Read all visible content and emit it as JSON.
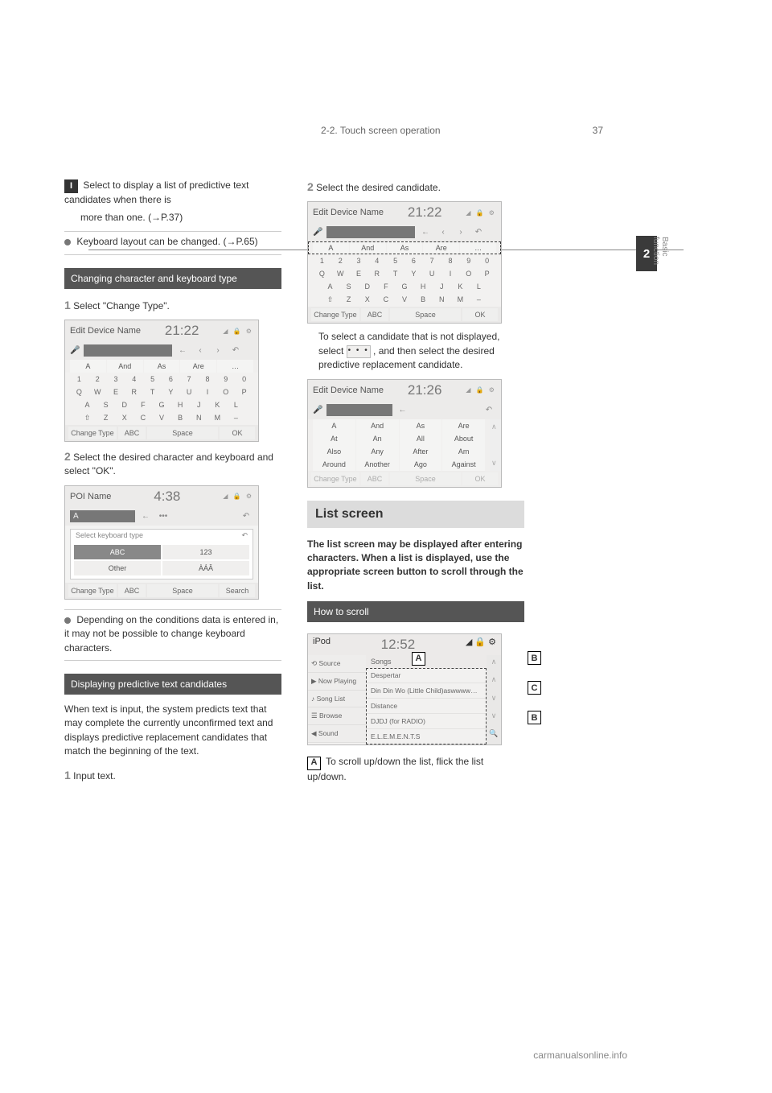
{
  "page": {
    "number": "37",
    "section": "2-2. Touch screen operation",
    "side_tab_number": "2",
    "side_tab_label": "Basic function"
  },
  "left": {
    "label_I": "I",
    "text_I_1": "Select to display a list of predictive text candidates when there is ",
    "text_I_2": "more than one.",
    "arrow_ref": "(→P.37)",
    "bullet_note": "Keyboard layout can be changed.",
    "bullet_ref": "(→P.65)",
    "heading1": "Changing character and keyboard type",
    "step1_num": "1",
    "step1_text": "Select \"Change Type\".",
    "step2_num": "2",
    "step2_text": "Select the desired character and keyboard and select \"OK\".",
    "bullet2_1": "Depending on the conditions data is entered in, it may not be possible to change keyboard characters.",
    "heading2": "Displaying predictive text candidates",
    "para2": "When text is input, the system predicts text that may complete the currently unconfirmed text and displays predictive replacement candidates that match the beginning of the text.",
    "step_b1_num": "1",
    "step_b1_text": "Input text."
  },
  "right": {
    "step2_num": "2",
    "step2_text": "Select the desired candidate.",
    "para_after": "To select a candidate that is not displayed, select , and then select the desired predictive replacement candidate.",
    "list_title": "List screen",
    "list_desc": "The list screen may be displayed after entering characters. When a list is displayed, use the appropriate screen button to scroll through the list.",
    "heading3": "How to scroll",
    "label_A": "A",
    "label_A_text": "To scroll up/down the list, flick the list up/down."
  },
  "shot1": {
    "title": "Edit Device Name",
    "time": "21:22",
    "icons": "◢ 🔒 ⚙",
    "suggest": [
      "A",
      "And",
      "As",
      "Are",
      "…"
    ],
    "row_num": [
      "1",
      "2",
      "3",
      "4",
      "5",
      "6",
      "7",
      "8",
      "9",
      "0"
    ],
    "row_q": [
      "Q",
      "W",
      "E",
      "R",
      "T",
      "Y",
      "U",
      "I",
      "O",
      "P"
    ],
    "row_a": [
      "A",
      "S",
      "D",
      "F",
      "G",
      "H",
      "J",
      "K",
      "L"
    ],
    "row_z": [
      "⇧",
      "Z",
      "X",
      "C",
      "V",
      "B",
      "N",
      "M",
      "–"
    ],
    "change": "Change Type",
    "abc": "ABC",
    "space": "Space",
    "ok": "OK"
  },
  "shot2": {
    "title": "POI Name",
    "time": "4:38",
    "icons": "◢ 🔒 ⚙",
    "input_letter": "A",
    "popup_title": "Select keyboard type",
    "cells": [
      "ABC",
      "123",
      "Other",
      "ÀÁÂ"
    ],
    "change": "Change Type",
    "abc": "ABC",
    "space": "Space",
    "search": "Search"
  },
  "shot3": {
    "title": "Edit Device Name",
    "time": "21:22",
    "icons": "◢ 🔒 ⚙",
    "suggest": [
      "A",
      "And",
      "As",
      "Are",
      "…"
    ],
    "row_num": [
      "1",
      "2",
      "3",
      "4",
      "5",
      "6",
      "7",
      "8",
      "9",
      "0"
    ],
    "row_q": [
      "Q",
      "W",
      "E",
      "R",
      "T",
      "Y",
      "U",
      "I",
      "O",
      "P"
    ],
    "row_a": [
      "A",
      "S",
      "D",
      "F",
      "G",
      "H",
      "J",
      "K",
      "L"
    ],
    "row_z": [
      "⇧",
      "Z",
      "X",
      "C",
      "V",
      "B",
      "N",
      "M",
      "–"
    ],
    "change": "Change Type",
    "abc": "ABC",
    "space": "Space",
    "ok": "OK"
  },
  "shot4": {
    "title": "Edit Device Name",
    "time": "21:26",
    "icons": "◢ 🔒 ⚙",
    "rows": [
      [
        "A",
        "And",
        "As",
        "Are"
      ],
      [
        "At",
        "An",
        "All",
        "About"
      ],
      [
        "Also",
        "Any",
        "After",
        "Am"
      ],
      [
        "Around",
        "Another",
        "Ago",
        "Against"
      ]
    ],
    "change": "Change Type",
    "abc": "ABC",
    "space": "Space",
    "ok": "OK"
  },
  "shot5": {
    "title": "iPod",
    "time": "12:52",
    "icons": "◢ 🔒 ⚙",
    "side": [
      "⟲ Source",
      "▶ Now Playing",
      "♪ Song List",
      "☰ Browse",
      "◀ Sound"
    ],
    "main_title": "Songs",
    "rows": [
      "Despertar",
      "Din Din Wo (Little Child)aswwww…",
      "Distance",
      "DJDJ (for RADIO)",
      "E.L.E.M.E.N.T.S"
    ],
    "scroll": [
      "∧",
      "∧",
      "∨",
      "∨",
      "🔍"
    ]
  },
  "callouts": {
    "A": "A",
    "B": "B",
    "C": "C"
  },
  "footer": "carmanualsonline.info"
}
